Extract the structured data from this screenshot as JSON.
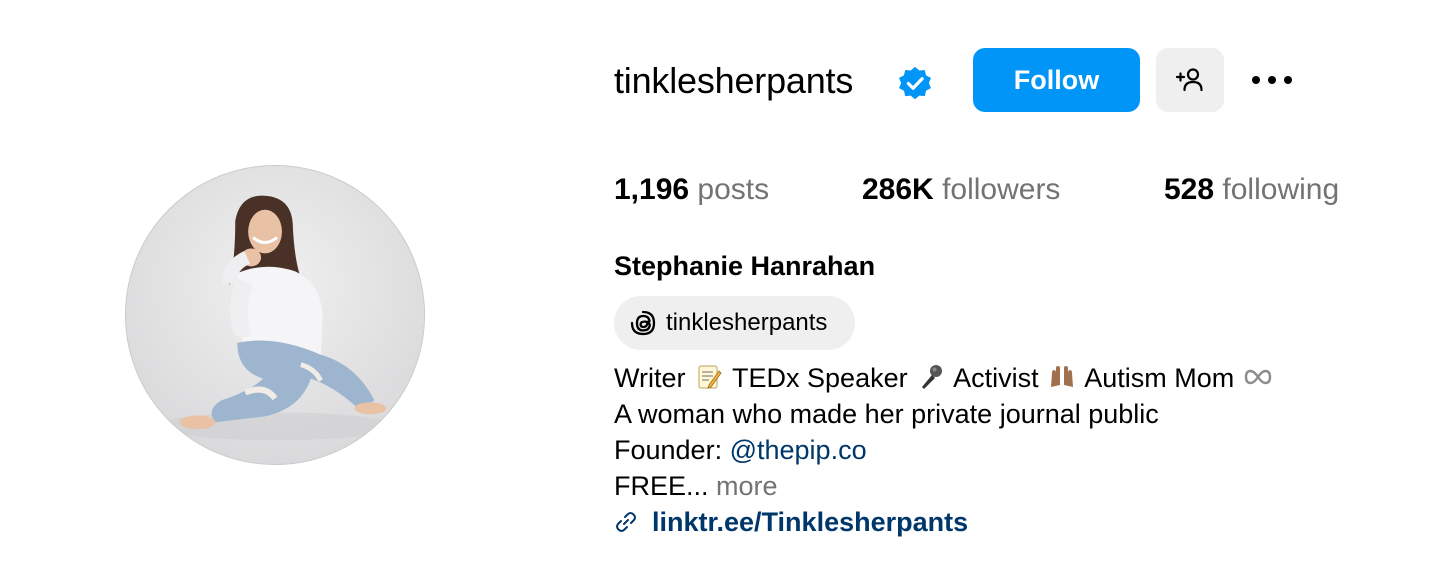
{
  "profile": {
    "username": "tinklesherpants",
    "verified": true,
    "full_name": "Stephanie Hanrahan",
    "threads_handle": "tinklesherpants"
  },
  "actions": {
    "follow_label": "Follow",
    "add_user_icon": "add-user-icon",
    "more_icon": "more-options-icon"
  },
  "stats": {
    "posts_count": "1,196",
    "posts_label": "posts",
    "followers_count": "286K",
    "followers_label": "followers",
    "following_count": "528",
    "following_label": "following"
  },
  "bio": {
    "line1_writer": "Writer",
    "line1_writer_emoji": "memo-emoji",
    "line1_tedx": "TEDx Speaker",
    "line1_tedx_emoji": "microphone-emoji",
    "line1_activist": "Activist",
    "line1_activist_emoji": "raising-hands-emoji",
    "line1_autism": "Autism Mom",
    "line1_autism_emoji": "infinity-emoji",
    "line2": "A woman who made her private journal public",
    "line3_prefix": "Founder:",
    "line3_mention": "@thepip.co",
    "line4_text": "FREE...",
    "line4_more": "more"
  },
  "link": {
    "text": "linktr.ee/Tinklesherpants",
    "icon": "link-icon"
  },
  "colors": {
    "follow_button": "#0095f6",
    "secondary_button": "#efefef",
    "verified_badge": "#0095f6",
    "link_text": "#00376b",
    "muted_text": "#737373"
  }
}
